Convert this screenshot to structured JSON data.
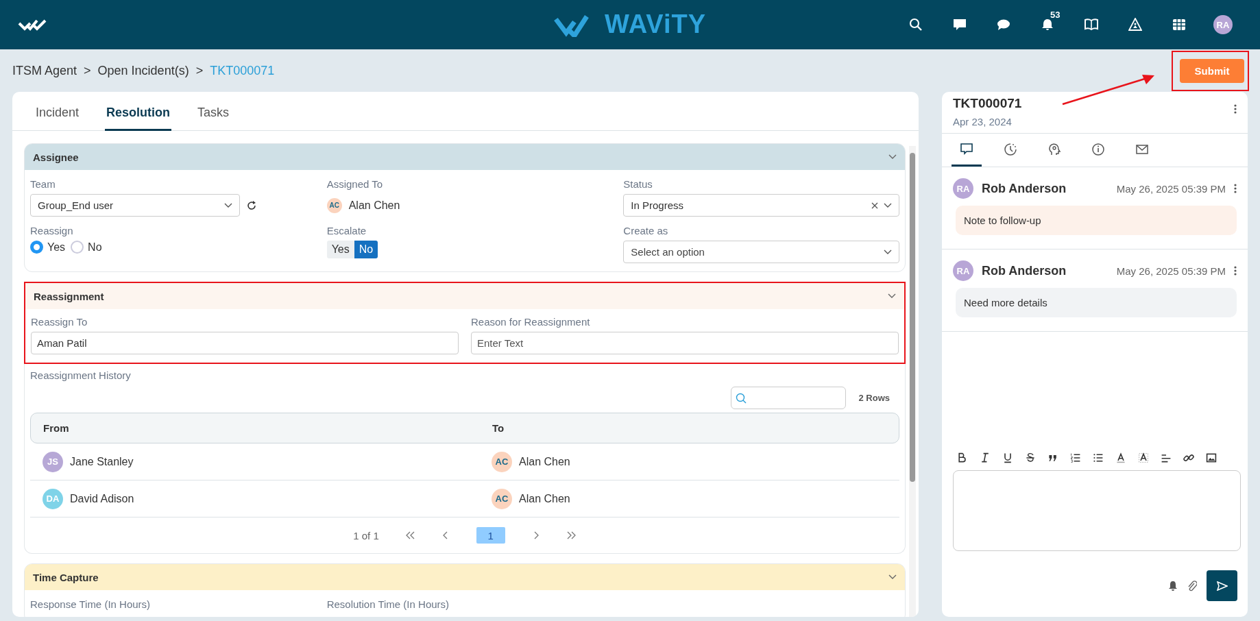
{
  "header": {
    "brand": "WAViTY",
    "notification_count": "53",
    "user_initials": "RA"
  },
  "breadcrumb": {
    "separator": ">",
    "items": [
      {
        "label": "ITSM Agent",
        "current": false
      },
      {
        "label": "Open Incident(s)",
        "current": false
      },
      {
        "label": "TKT000071",
        "current": true
      }
    ]
  },
  "submit": {
    "label": "Submit",
    "highlighted": true
  },
  "tabs": [
    {
      "label": "Incident",
      "selected": false
    },
    {
      "label": "Resolution",
      "selected": true
    },
    {
      "label": "Tasks",
      "selected": false
    }
  ],
  "assignee": {
    "title": "Assignee",
    "team": {
      "label": "Team",
      "value": "Group_End user"
    },
    "assigned_to": {
      "label": "Assigned To",
      "initials": "AC",
      "name": "Alan Chen"
    },
    "status": {
      "label": "Status",
      "value": "In Progress"
    },
    "reassign": {
      "label": "Reassign",
      "options": [
        {
          "label": "Yes",
          "selected": true
        },
        {
          "label": "No",
          "selected": false
        }
      ]
    },
    "escalate": {
      "label": "Escalate",
      "options": [
        {
          "label": "Yes",
          "selected": false
        },
        {
          "label": "No",
          "selected": true
        }
      ]
    },
    "create_as": {
      "label": "Create as",
      "placeholder": "Select an option"
    }
  },
  "reassignment": {
    "title": "Reassignment",
    "highlighted": true,
    "reassign_to": {
      "label": "Reassign To",
      "value": "Aman Patil"
    },
    "reason": {
      "label": "Reason for Reassignment",
      "placeholder": "Enter Text"
    }
  },
  "history": {
    "title": "Reassignment History",
    "row_count": "2 Rows",
    "columns": [
      "From",
      "To"
    ],
    "rows": [
      {
        "from": {
          "initials": "JS",
          "name": "Jane Stanley",
          "color": "#b7a8d6"
        },
        "to": {
          "initials": "AC",
          "name": "Alan Chen",
          "color": "#fbd3bd"
        }
      },
      {
        "from": {
          "initials": "DA",
          "name": "David Adison",
          "color": "#7fd3e8"
        },
        "to": {
          "initials": "AC",
          "name": "Alan Chen",
          "color": "#fbd3bd"
        }
      }
    ],
    "pagination": {
      "summary": "1 of 1",
      "pages": [
        {
          "label": "1",
          "selected": true
        }
      ]
    }
  },
  "time_capture": {
    "title": "Time Capture",
    "fields": [
      "Response Time (In Hours)",
      "Resolution Time (In Hours)"
    ]
  },
  "ticket": {
    "id": "TKT000071",
    "date": "Apr 23, 2024",
    "tabs": [
      {
        "kind": "comments",
        "selected": true
      },
      {
        "kind": "history",
        "selected": false
      },
      {
        "kind": "insights",
        "selected": false
      },
      {
        "kind": "details",
        "selected": false
      },
      {
        "kind": "email",
        "selected": false
      }
    ],
    "comments": [
      {
        "initials": "RA",
        "author": "Rob Anderson",
        "time": "May 26, 2025 05:39 PM",
        "kind": "note",
        "text": "Note to follow-up"
      },
      {
        "initials": "RA",
        "author": "Rob Anderson",
        "time": "May 26, 2025 05:39 PM",
        "kind": "reply",
        "text": "Need more details"
      }
    ]
  }
}
